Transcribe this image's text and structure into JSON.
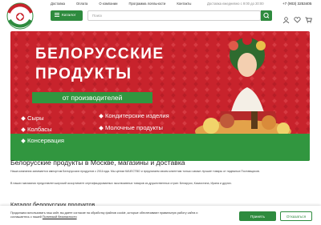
{
  "header": {
    "logo_text": "БЕЛОРУССКИЕ ПРОДУКТЫ",
    "nav": [
      "Доставка",
      "Оплата",
      "О компании",
      "Программа лояльности",
      "Контакты"
    ],
    "delivery_text": "Доставка ежедневно с 9:00 до 20:00",
    "phone": "+7 (903) 3253405",
    "catalog_label": "Каталог",
    "search_placeholder": "Поиск"
  },
  "banner": {
    "title_line1": "БЕЛОРУССКИЕ",
    "title_line2": "ПРОДУКТЫ",
    "subtitle": "от производителей",
    "bullets": [
      "Сыры",
      "Колбасы",
      "Консервация",
      "Кондитерские изделия",
      "Молочные продукты"
    ]
  },
  "content": {
    "heading": "Белорусские продукты в Москве, магазины и доставка",
    "paragraph1": "Наша компания занимается импортом Белорусских продуктов с 2011года. Мы ценим КАЧЕСТВО и предлагаем своим клиентам только самые лучшие товары от надежных Поставщиков.",
    "paragraph2": "В наших магазинах представлен широкий ассортимент сертифицированных эксклюзивных товаров из дружественных стран: Беларуси, Казахстана, Ирана и других.",
    "catalog_heading": "Каталог белорусских продуктов"
  },
  "cookie": {
    "text": "Продолжая использовать наш сайт, вы даете согласие на обработку файлов cookie, которые обеспечивают правильную работу сайта и соглашаетесь с нашей",
    "link": "Политикой безопасности",
    "accept": "Принять",
    "decline": "Отказаться"
  },
  "colors": {
    "brand_green": "#2e8b3e",
    "banner_red": "#c8232c"
  }
}
